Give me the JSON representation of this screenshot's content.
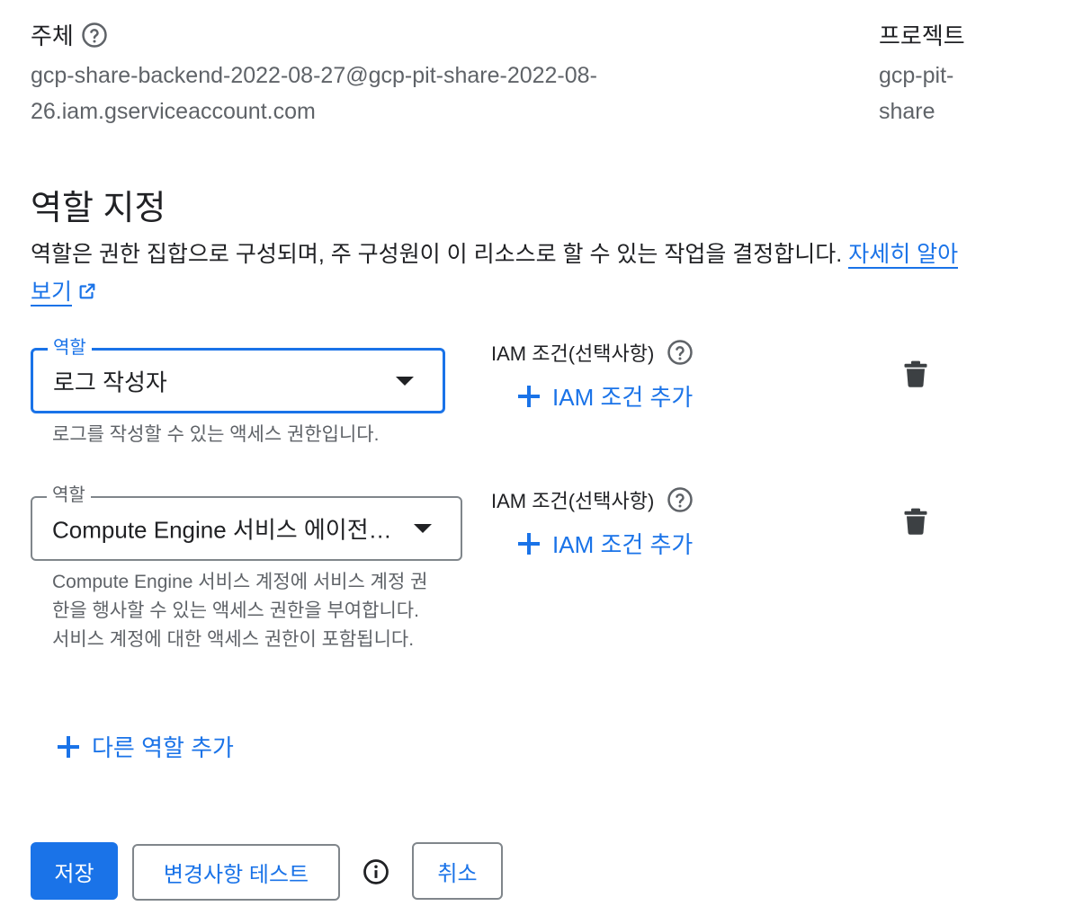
{
  "principal": {
    "label": "주체",
    "value": "gcp-share-backend-2022-08-27@gcp-pit-share-2022-08-26.iam.gserviceaccount.com"
  },
  "project": {
    "label": "프로젝트",
    "value": "gcp-pit-share"
  },
  "roles_section": {
    "title": "역할 지정",
    "description": "역할은 권한 집합으로 구성되며, 주 구성원이 이 리소스로 할 수 있는 작업을 결정합니다.",
    "learn_more": "자세히 알아보기"
  },
  "roles": [
    {
      "field_label": "역할",
      "value": "로그 작성자",
      "hint": "로그를 작성할 수 있는 액세스 권한입니다.",
      "condition_label": "IAM 조건(선택사항)",
      "add_condition": "IAM 조건 추가"
    },
    {
      "field_label": "역할",
      "value": "Compute Engine 서비스 에이전…",
      "hint": "Compute Engine 서비스 계정에 서비스 계정 권한을 행사할 수 있는 액세스 권한을 부여합니다. 서비스 계정에 대한 액세스 권한이 포함됩니다.",
      "condition_label": "IAM 조건(선택사항)",
      "add_condition": "IAM 조건 추가"
    }
  ],
  "add_role": "다른 역할 추가",
  "actions": {
    "save": "저장",
    "test_changes": "변경사항 테스트",
    "cancel": "취소"
  },
  "colors": {
    "accent": "#1a73e8",
    "text": "#202124",
    "secondary_text": "#5f6368",
    "border": "#80868b"
  }
}
